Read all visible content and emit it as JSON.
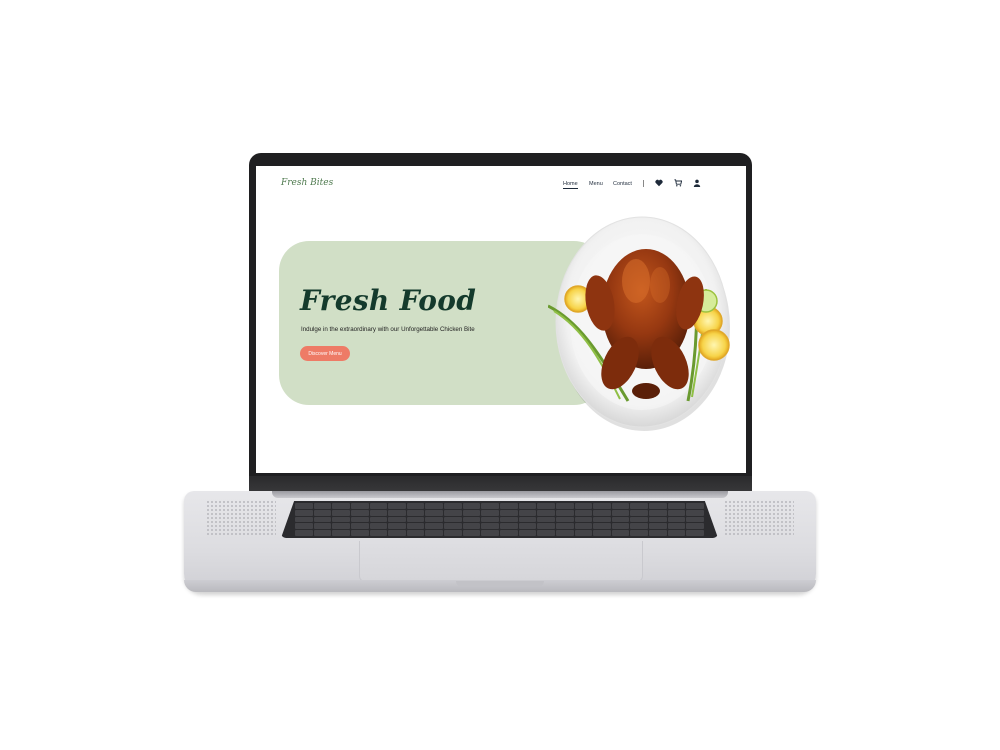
{
  "site": {
    "brand": "Fresh Bites",
    "nav": {
      "links": [
        {
          "label": "Home",
          "active": true
        },
        {
          "label": "Menu",
          "active": false
        },
        {
          "label": "Contact",
          "active": false
        }
      ],
      "icons": [
        "heart-icon",
        "cart-icon",
        "user-icon"
      ]
    },
    "hero": {
      "title": "Fresh Food",
      "subtitle": "Indulge in the extraordinary with our Unforgettable Chicken Bite",
      "cta_label": "Discover Menu"
    }
  },
  "colors": {
    "hero_bg": "#d1dfc6",
    "title": "#143a2c",
    "cta": "#ee7b66",
    "brand": "#4f7a4f"
  }
}
